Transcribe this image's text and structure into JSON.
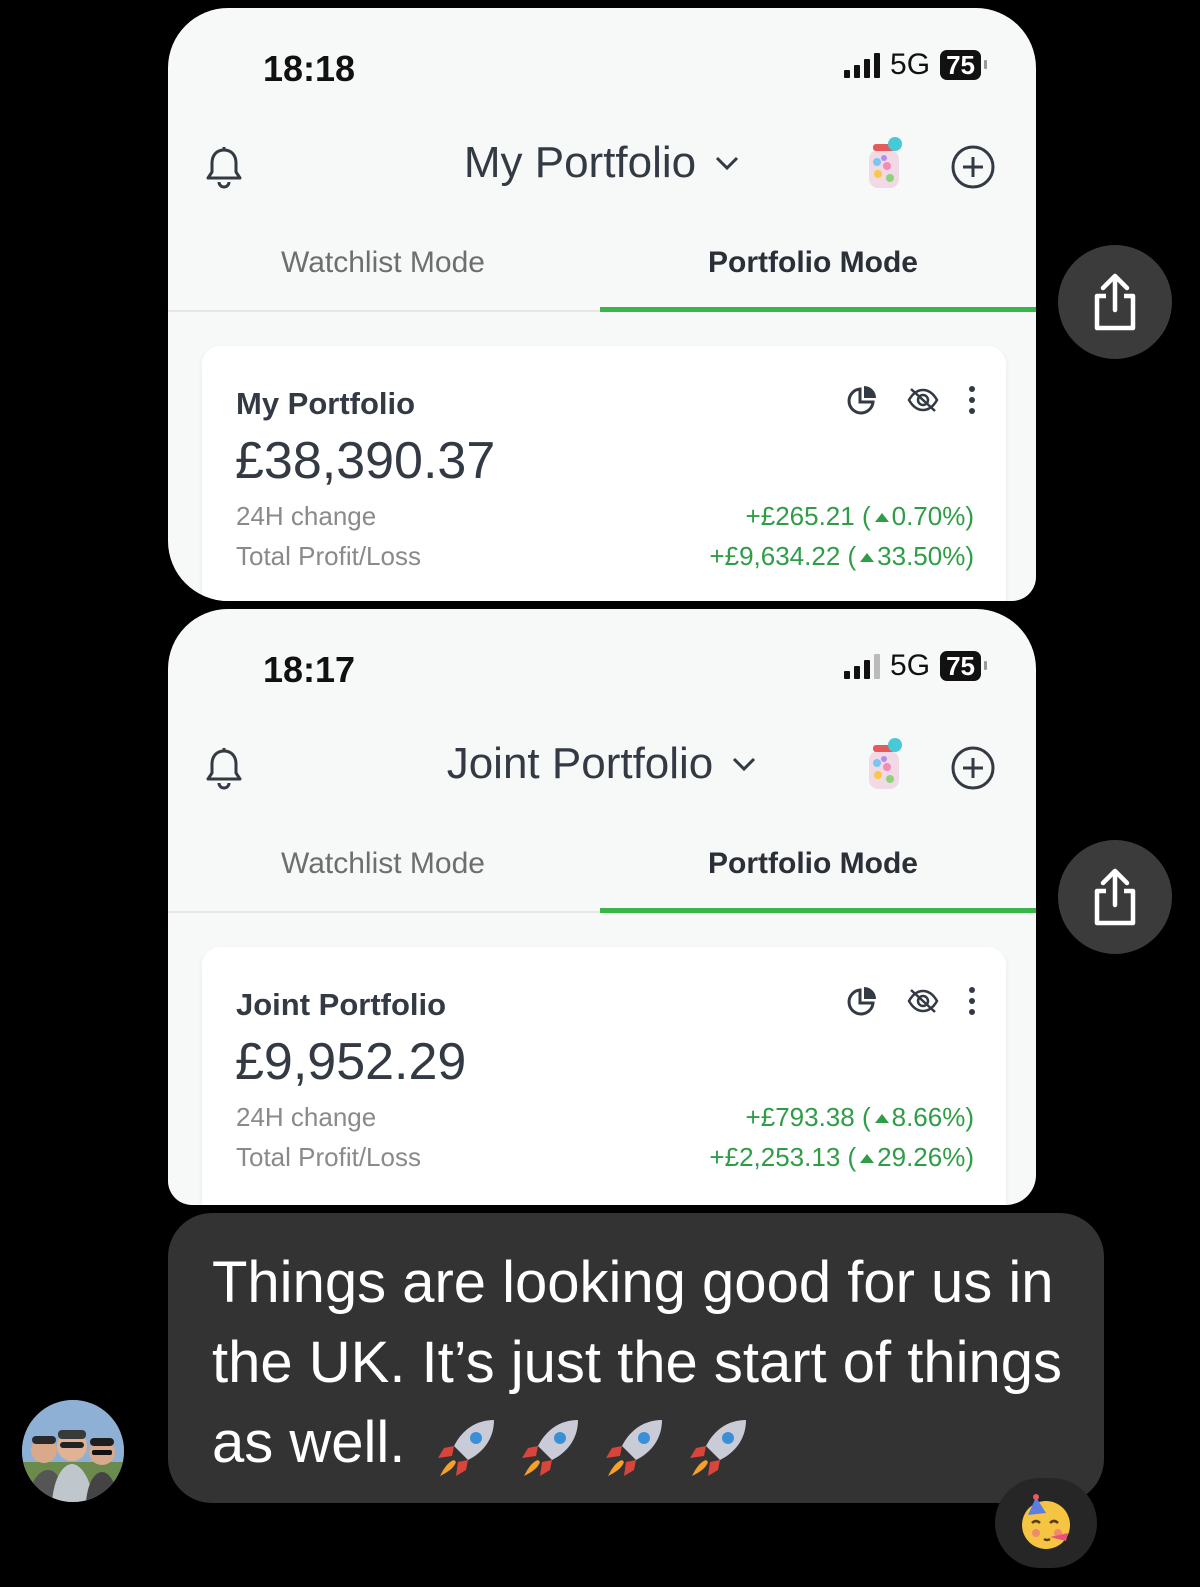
{
  "screenshots": [
    {
      "time": "18:18",
      "network": "5G",
      "battery": "75",
      "portfolio_title": "My Portfolio",
      "tabs": {
        "watchlist": "Watchlist Mode",
        "portfolio": "Portfolio Mode"
      },
      "card": {
        "name": "My Portfolio",
        "value": "£38,390.37",
        "change_label": "24H change",
        "change_amount": "+£265.21 (",
        "change_pct": "0.70%)",
        "pl_label": "Total Profit/Loss",
        "pl_amount": "+£9,634.22 (",
        "pl_pct": "33.50%)"
      }
    },
    {
      "time": "18:17",
      "network": "5G",
      "battery": "75",
      "portfolio_title": "Joint Portfolio",
      "tabs": {
        "watchlist": "Watchlist Mode",
        "portfolio": "Portfolio Mode"
      },
      "card": {
        "name": "Joint Portfolio",
        "value": "£9,952.29",
        "change_label": "24H change",
        "change_amount": "+£793.38 (",
        "change_pct": "8.66%)",
        "pl_label": "Total Profit/Loss",
        "pl_amount": "+£2,253.13 (",
        "pl_pct": "29.26%)"
      }
    }
  ],
  "message": {
    "text": "Things are looking good for us in the UK. It’s just the start of things as well.",
    "emojis": [
      "rocket-icon",
      "rocket-icon",
      "rocket-icon",
      "rocket-icon"
    ]
  },
  "reaction": "partying-face-icon",
  "colors": {
    "accent_green": "#3ab54a",
    "gain_green": "#2e9d46",
    "bubble": "#333333",
    "background": "#000000"
  }
}
